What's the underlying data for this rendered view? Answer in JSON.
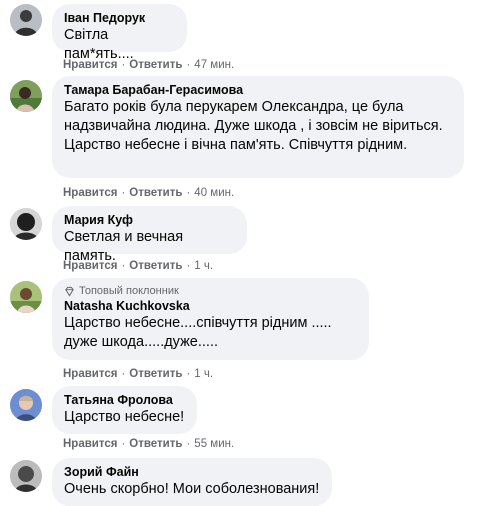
{
  "actions": {
    "like": "Нравится",
    "reply": "Ответить",
    "separator": "·"
  },
  "comments": [
    {
      "author": "Іван Педорук",
      "text": "Світла пам*ять....",
      "time": "47 мин."
    },
    {
      "author": "Тамара Барабан-Герасимова",
      "text": "Багато років була перукарем Олександра, це була надзвичайна людина. Дуже шкода , і зовсім не віриться. Царство небесне і вічна пам'ять. Співчуття рідним.",
      "time": "40 мин."
    },
    {
      "author": "Мария Куф",
      "text": "Светлая и вечная память.",
      "time": "1 ч."
    },
    {
      "badge": "Топовый поклонник",
      "author": "Natasha Kuchkovska",
      "text": "Царство небесне....співчуття рідним ..... дуже шкода.....дуже.....",
      "time": "1 ч."
    },
    {
      "author": "Татьяна Фролова",
      "text": "Царство небесне!",
      "time": "55 мин."
    },
    {
      "author": "Зорий Файн",
      "text": "Очень скорбно! Мои соболезнования!"
    }
  ]
}
